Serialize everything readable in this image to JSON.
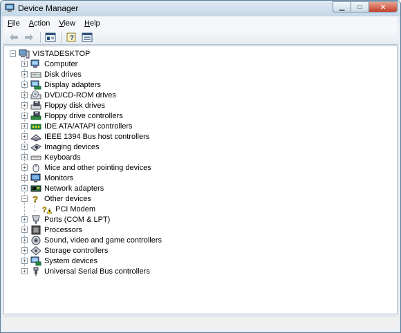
{
  "window": {
    "title": "Device Manager"
  },
  "title_buttons": {
    "minimize": "▁",
    "maximize": "□",
    "close": "✕"
  },
  "menu": [
    {
      "label_pre": "",
      "hotkey": "F",
      "label_post": "ile"
    },
    {
      "label_pre": "",
      "hotkey": "A",
      "label_post": "ction"
    },
    {
      "label_pre": "",
      "hotkey": "V",
      "label_post": "iew"
    },
    {
      "label_pre": "",
      "hotkey": "H",
      "label_post": "elp"
    }
  ],
  "toolbar": [
    "back-arrow-icon",
    "forward-arrow-icon",
    "properties-icon",
    "help-icon",
    "scan-hardware-icon"
  ],
  "tree": {
    "root": "VISTADESKTOP",
    "categories": [
      {
        "label": "Computer",
        "icon": "computer-icon"
      },
      {
        "label": "Disk drives",
        "icon": "disk-drive-icon"
      },
      {
        "label": "Display adapters",
        "icon": "display-adapter-icon"
      },
      {
        "label": "DVD/CD-ROM drives",
        "icon": "dvd-drive-icon"
      },
      {
        "label": "Floppy disk drives",
        "icon": "floppy-drive-icon"
      },
      {
        "label": "Floppy drive controllers",
        "icon": "floppy-controller-icon"
      },
      {
        "label": "IDE ATA/ATAPI controllers",
        "icon": "ide-controller-icon"
      },
      {
        "label": "IEEE 1394 Bus host controllers",
        "icon": "ieee1394-icon"
      },
      {
        "label": "Imaging devices",
        "icon": "camera-icon"
      },
      {
        "label": "Keyboards",
        "icon": "keyboard-icon"
      },
      {
        "label": "Mice and other pointing devices",
        "icon": "mouse-icon"
      },
      {
        "label": "Monitors",
        "icon": "monitor-icon"
      },
      {
        "label": "Network adapters",
        "icon": "network-adapter-icon"
      },
      {
        "label": "Other devices",
        "icon": "unknown-device-icon",
        "expanded": true,
        "children": [
          {
            "label": "PCI Modem",
            "icon": "warning-device-icon"
          }
        ]
      },
      {
        "label": "Ports (COM & LPT)",
        "icon": "port-icon"
      },
      {
        "label": "Processors",
        "icon": "processor-icon"
      },
      {
        "label": "Sound, video and game controllers",
        "icon": "sound-icon"
      },
      {
        "label": "Storage controllers",
        "icon": "storage-controller-icon"
      },
      {
        "label": "System devices",
        "icon": "system-device-icon"
      },
      {
        "label": "Universal Serial Bus controllers",
        "icon": "usb-icon"
      }
    ]
  },
  "colors": {
    "title_gradient_top": "#dfeaf4",
    "close_button": "#c4402a",
    "tree_background": "#ffffff"
  }
}
